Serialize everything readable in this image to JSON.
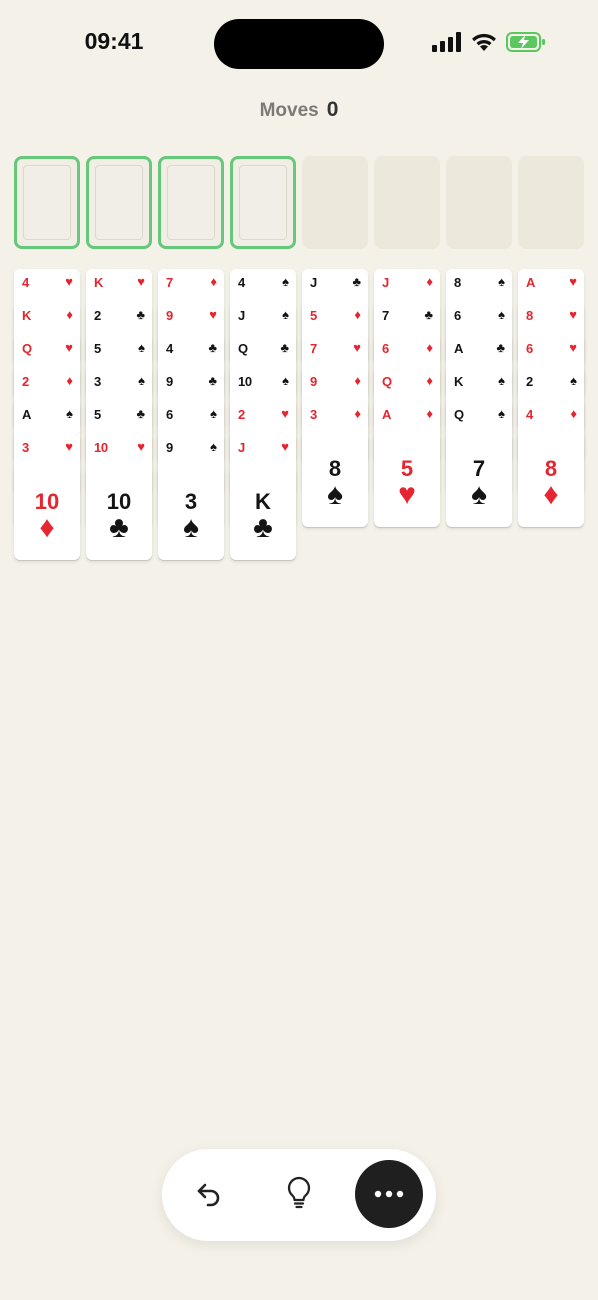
{
  "status_bar": {
    "time": "09:41",
    "icons": [
      "signal-icon",
      "wifi-icon",
      "battery-charging-icon"
    ]
  },
  "header": {
    "moves_label": "Moves",
    "moves_value": "0"
  },
  "free_cells": [
    {
      "state": "empty"
    },
    {
      "state": "empty"
    },
    {
      "state": "empty"
    },
    {
      "state": "empty"
    }
  ],
  "foundations": [
    {
      "state": "empty"
    },
    {
      "state": "empty"
    },
    {
      "state": "empty"
    },
    {
      "state": "empty"
    }
  ],
  "suits": {
    "hearts": "♥",
    "diamonds": "♦",
    "clubs": "♣",
    "spades": "♠"
  },
  "colors": {
    "red": "#e5252f",
    "black": "#141414",
    "freecell_border": "#66c97a",
    "background": "#f4f1e8"
  },
  "tableau": [
    [
      {
        "rank": "4",
        "suit": "hearts"
      },
      {
        "rank": "K",
        "suit": "diamonds"
      },
      {
        "rank": "Q",
        "suit": "hearts"
      },
      {
        "rank": "2",
        "suit": "diamonds"
      },
      {
        "rank": "A",
        "suit": "spades"
      },
      {
        "rank": "3",
        "suit": "hearts"
      },
      {
        "rank": "10",
        "suit": "diamonds"
      }
    ],
    [
      {
        "rank": "K",
        "suit": "hearts"
      },
      {
        "rank": "2",
        "suit": "clubs"
      },
      {
        "rank": "5",
        "suit": "spades"
      },
      {
        "rank": "3",
        "suit": "spades"
      },
      {
        "rank": "5",
        "suit": "clubs"
      },
      {
        "rank": "10",
        "suit": "hearts"
      },
      {
        "rank": "10",
        "suit": "clubs"
      }
    ],
    [
      {
        "rank": "7",
        "suit": "diamonds"
      },
      {
        "rank": "9",
        "suit": "hearts"
      },
      {
        "rank": "4",
        "suit": "clubs"
      },
      {
        "rank": "9",
        "suit": "clubs"
      },
      {
        "rank": "6",
        "suit": "spades"
      },
      {
        "rank": "9",
        "suit": "spades"
      },
      {
        "rank": "3",
        "suit": "spades"
      }
    ],
    [
      {
        "rank": "4",
        "suit": "spades"
      },
      {
        "rank": "J",
        "suit": "spades"
      },
      {
        "rank": "Q",
        "suit": "clubs"
      },
      {
        "rank": "10",
        "suit": "spades"
      },
      {
        "rank": "2",
        "suit": "hearts"
      },
      {
        "rank": "J",
        "suit": "hearts"
      },
      {
        "rank": "K",
        "suit": "clubs"
      }
    ],
    [
      {
        "rank": "J",
        "suit": "clubs"
      },
      {
        "rank": "5",
        "suit": "diamonds"
      },
      {
        "rank": "7",
        "suit": "hearts"
      },
      {
        "rank": "9",
        "suit": "diamonds"
      },
      {
        "rank": "3",
        "suit": "diamonds"
      },
      {
        "rank": "8",
        "suit": "spades"
      }
    ],
    [
      {
        "rank": "J",
        "suit": "diamonds"
      },
      {
        "rank": "7",
        "suit": "clubs"
      },
      {
        "rank": "6",
        "suit": "diamonds"
      },
      {
        "rank": "Q",
        "suit": "diamonds"
      },
      {
        "rank": "A",
        "suit": "diamonds"
      },
      {
        "rank": "5",
        "suit": "hearts"
      }
    ],
    [
      {
        "rank": "8",
        "suit": "spades"
      },
      {
        "rank": "6",
        "suit": "spades"
      },
      {
        "rank": "A",
        "suit": "clubs"
      },
      {
        "rank": "K",
        "suit": "spades"
      },
      {
        "rank": "Q",
        "suit": "spades"
      },
      {
        "rank": "7",
        "suit": "spades"
      }
    ],
    [
      {
        "rank": "A",
        "suit": "hearts"
      },
      {
        "rank": "8",
        "suit": "hearts"
      },
      {
        "rank": "6",
        "suit": "hearts"
      },
      {
        "rank": "2",
        "suit": "spades"
      },
      {
        "rank": "4",
        "suit": "diamonds"
      },
      {
        "rank": "8",
        "suit": "diamonds"
      }
    ]
  ],
  "toolbar": {
    "buttons": [
      {
        "name": "undo-button",
        "icon": "undo-icon"
      },
      {
        "name": "hint-button",
        "icon": "lightbulb-icon"
      },
      {
        "name": "menu-button",
        "icon": "more-icon"
      }
    ]
  }
}
